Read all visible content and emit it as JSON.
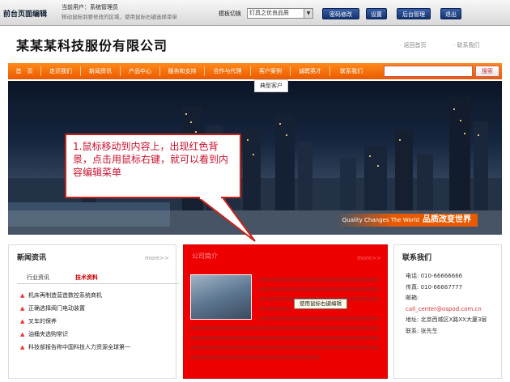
{
  "adminbar": {
    "brand": "前台页面编辑",
    "user": "当前用户：系统管理员",
    "hint": "移动鼠标到要修改的区域，使用鼠标右键选择菜单",
    "template_label": "模板切换",
    "template_value": "灯具之优良品质",
    "buttons": [
      "密码修改",
      "设置",
      "后台管理",
      "退出"
    ]
  },
  "header": {
    "company": "某某某科技服份有限公司",
    "links": [
      "返回首页",
      "联系我们"
    ]
  },
  "nav": {
    "items": [
      "首　页",
      "走近我们",
      "新闻资讯",
      "产品中心",
      "服务和支持",
      "合作与代理",
      "客户案例",
      "诚聘英才",
      "联系我们"
    ],
    "search_button": "搜索",
    "dropdown_item": "典型客户"
  },
  "banner": {
    "tagline_en": "Quality Changes The World",
    "tagline_cn": "品质改变世界"
  },
  "callout": {
    "text": "1.鼠标移动到内容上，出现红色背景，点击用鼠标右键，就可以看到内容编辑菜单"
  },
  "news": {
    "title": "新闻资讯",
    "more": "more>>",
    "tabs": [
      "行业资讯",
      "技术资料"
    ],
    "items": [
      "机床再制造营造数控系统商机",
      "正确选择阀门电动装置",
      "叉车的保养",
      "油桶夹选购常识",
      "科技部报告称中国科技人力资源全球第一"
    ]
  },
  "about": {
    "title": "公司简介",
    "more": "more>>",
    "tooltip": "使用鼠标右键编辑"
  },
  "contact": {
    "title": "联系我们",
    "phone1": "电话: 010-66666666",
    "phone2": "传真: 010-66667777",
    "mail_label": "邮箱:",
    "email": "call_center@ospod.com.cn",
    "address": "地址: 北京西城区X路XX大厦3层",
    "person": "联系: 张先生"
  },
  "colors": {
    "nav": "#f07a10",
    "highlight": "#ee0000",
    "admin_button": "#1c3f86"
  }
}
